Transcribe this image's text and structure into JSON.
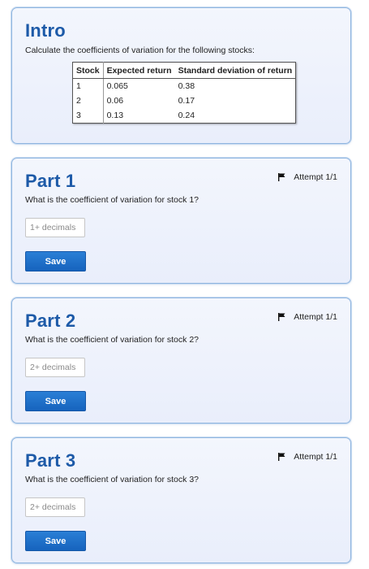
{
  "intro": {
    "title": "Intro",
    "description": "Calculate the coefficients of variation for the following stocks:",
    "table": {
      "headers": [
        "Stock",
        "Expected return",
        "Standard deviation of return"
      ],
      "rows": [
        [
          "1",
          "0.065",
          "0.38"
        ],
        [
          "2",
          "0.06",
          "0.17"
        ],
        [
          "3",
          "0.13",
          "0.24"
        ]
      ]
    }
  },
  "parts": [
    {
      "title": "Part 1",
      "question": "What is the coefficient of variation for stock 1?",
      "attempt": "Attempt 1/1",
      "placeholder": "1+ decimals",
      "save_label": "Save"
    },
    {
      "title": "Part 2",
      "question": "What is the coefficient of variation for stock 2?",
      "attempt": "Attempt 1/1",
      "placeholder": "2+ decimals",
      "save_label": "Save"
    },
    {
      "title": "Part 3",
      "question": "What is the coefficient of variation for stock 3?",
      "attempt": "Attempt 1/1",
      "placeholder": "2+ decimals",
      "save_label": "Save"
    }
  ],
  "icons": {
    "attempt": "flag-icon"
  },
  "colors": {
    "title": "#1d5aa8",
    "card_border": "#8fb5df",
    "button": "#1663bd"
  }
}
